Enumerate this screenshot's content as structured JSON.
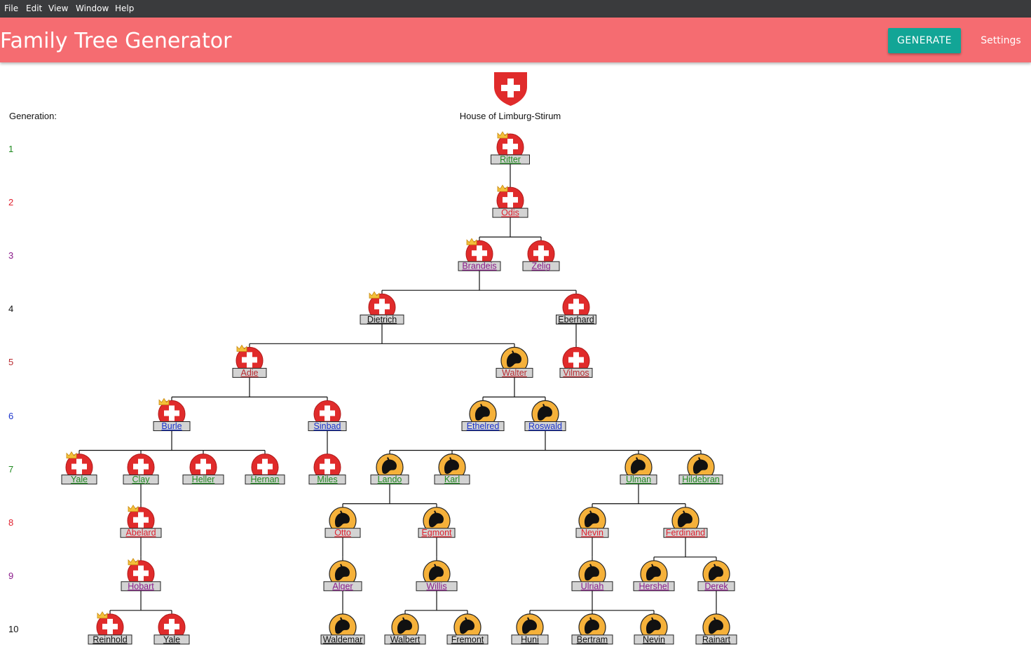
{
  "menu": [
    "File",
    "Edit",
    "View",
    "Window",
    "Help"
  ],
  "app": {
    "title": "Family Tree Generator",
    "generate_label": "GENERATE",
    "settings_label": "Settings"
  },
  "house": {
    "name": "House of Limburg-Stirum"
  },
  "generation_label": "Generation:",
  "generations": [
    {
      "n": "1",
      "color": "#1f8a1f"
    },
    {
      "n": "2",
      "color": "#e0202d"
    },
    {
      "n": "3",
      "color": "#8a1a8a"
    },
    {
      "n": "4",
      "color": "#111111"
    },
    {
      "n": "5",
      "color": "#b8282e"
    },
    {
      "n": "6",
      "color": "#1a33cc"
    },
    {
      "n": "7",
      "color": "#1f8a1f"
    },
    {
      "n": "8",
      "color": "#e0202d"
    },
    {
      "n": "9",
      "color": "#8a1a8a"
    },
    {
      "n": "10",
      "color": "#111111"
    }
  ],
  "colors": {
    "swiss_red": "#e02b2b",
    "lion_gold": "#f5b13a",
    "crown_gold": "#f3c03a",
    "label_bg": "#d3d3d3"
  },
  "people": [
    {
      "id": "ritter",
      "name": "Ritter",
      "gen": 1,
      "crest": "swiss",
      "crown": true
    },
    {
      "id": "odis",
      "name": "Odis",
      "gen": 2,
      "crest": "swiss",
      "crown": true,
      "parent": "ritter"
    },
    {
      "id": "brandeis",
      "name": "Brandeis",
      "gen": 3,
      "crest": "swiss",
      "crown": true,
      "parent": "odis"
    },
    {
      "id": "zelig",
      "name": "Zelig",
      "gen": 3,
      "crest": "swiss",
      "crown": false,
      "parent": "odis"
    },
    {
      "id": "dietrich",
      "name": "Dietrich",
      "gen": 4,
      "crest": "swiss",
      "crown": true,
      "parent": "brandeis"
    },
    {
      "id": "eberhard",
      "name": "Eberhard",
      "gen": 4,
      "crest": "swiss",
      "crown": false,
      "parent": "brandeis"
    },
    {
      "id": "adie",
      "name": "Adie",
      "gen": 5,
      "crest": "swiss",
      "crown": true,
      "parent": "dietrich"
    },
    {
      "id": "walter",
      "name": "Walter",
      "gen": 5,
      "crest": "lion",
      "crown": false,
      "parent": "dietrich"
    },
    {
      "id": "vilmos",
      "name": "Vilmos",
      "gen": 5,
      "crest": "swiss",
      "crown": false,
      "parent": "eberhard"
    },
    {
      "id": "burle",
      "name": "Burle",
      "gen": 6,
      "crest": "swiss",
      "crown": true,
      "parent": "adie"
    },
    {
      "id": "sinbad",
      "name": "Sinbad",
      "gen": 6,
      "crest": "swiss",
      "crown": false,
      "parent": "adie"
    },
    {
      "id": "ethelred",
      "name": "Ethelred",
      "gen": 6,
      "crest": "lion",
      "crown": false,
      "parent": "walter"
    },
    {
      "id": "roswald",
      "name": "Roswald",
      "gen": 6,
      "crest": "lion",
      "crown": false,
      "parent": "walter"
    },
    {
      "id": "yale7",
      "name": "Yale",
      "gen": 7,
      "crest": "swiss",
      "crown": true,
      "parent": "burle"
    },
    {
      "id": "clay",
      "name": "Clay",
      "gen": 7,
      "crest": "swiss",
      "crown": false,
      "parent": "burle"
    },
    {
      "id": "heller",
      "name": "Heller",
      "gen": 7,
      "crest": "swiss",
      "crown": false,
      "parent": "burle"
    },
    {
      "id": "hernan",
      "name": "Hernan",
      "gen": 7,
      "crest": "swiss",
      "crown": false,
      "parent": "burle"
    },
    {
      "id": "miles",
      "name": "Miles",
      "gen": 7,
      "crest": "swiss",
      "crown": false,
      "parent": "sinbad"
    },
    {
      "id": "lando",
      "name": "Lando",
      "gen": 7,
      "crest": "lion",
      "crown": false,
      "parent": "roswald"
    },
    {
      "id": "karl",
      "name": "Karl",
      "gen": 7,
      "crest": "lion",
      "crown": false,
      "parent": "roswald"
    },
    {
      "id": "ulman",
      "name": "Ulman",
      "gen": 7,
      "crest": "lion",
      "crown": false,
      "parent": "roswald"
    },
    {
      "id": "hildebran",
      "name": "Hildebran",
      "gen": 7,
      "crest": "lion",
      "crown": false,
      "parent": "roswald"
    },
    {
      "id": "abelard",
      "name": "Abelard",
      "gen": 8,
      "crest": "swiss",
      "crown": true,
      "parent": "clay"
    },
    {
      "id": "otto",
      "name": "Otto",
      "gen": 8,
      "crest": "lion",
      "crown": false,
      "parent": "lando"
    },
    {
      "id": "egmont",
      "name": "Egmont",
      "gen": 8,
      "crest": "lion",
      "crown": false,
      "parent": "lando"
    },
    {
      "id": "nevin8",
      "name": "Nevin",
      "gen": 8,
      "crest": "lion",
      "crown": false,
      "parent": "ulman"
    },
    {
      "id": "ferdinand",
      "name": "Ferdinand",
      "gen": 8,
      "crest": "lion",
      "crown": false,
      "parent": "ulman"
    },
    {
      "id": "hobart",
      "name": "Hobart",
      "gen": 9,
      "crest": "swiss",
      "crown": true,
      "parent": "abelard"
    },
    {
      "id": "alger",
      "name": "Alger",
      "gen": 9,
      "crest": "lion",
      "crown": false,
      "parent": "otto"
    },
    {
      "id": "willis",
      "name": "Willis",
      "gen": 9,
      "crest": "lion",
      "crown": false,
      "parent": "egmont"
    },
    {
      "id": "ulriah",
      "name": "Ulriah",
      "gen": 9,
      "crest": "lion",
      "crown": false,
      "parent": "nevin8"
    },
    {
      "id": "hershel",
      "name": "Hershel",
      "gen": 9,
      "crest": "lion",
      "crown": false,
      "parent": "ferdinand"
    },
    {
      "id": "derek",
      "name": "Derek",
      "gen": 9,
      "crest": "lion",
      "crown": false,
      "parent": "ferdinand"
    },
    {
      "id": "reinhold",
      "name": "Reinhold",
      "gen": 10,
      "crest": "swiss",
      "crown": true,
      "parent": "hobart"
    },
    {
      "id": "yale10",
      "name": "Yale",
      "gen": 10,
      "crest": "swiss",
      "crown": false,
      "parent": "hobart"
    },
    {
      "id": "waldemar",
      "name": "Waldemar",
      "gen": 10,
      "crest": "lion",
      "crown": false,
      "parent": "alger"
    },
    {
      "id": "walbert",
      "name": "Walbert",
      "gen": 10,
      "crest": "lion",
      "crown": false,
      "parent": "willis"
    },
    {
      "id": "fremont",
      "name": "Fremont",
      "gen": 10,
      "crest": "lion",
      "crown": false,
      "parent": "willis"
    },
    {
      "id": "huni",
      "name": "Huni",
      "gen": 10,
      "crest": "lion",
      "crown": false,
      "parent": "ulriah"
    },
    {
      "id": "bertram",
      "name": "Bertram",
      "gen": 10,
      "crest": "lion",
      "crown": false,
      "parent": "ulriah"
    },
    {
      "id": "nevin10",
      "name": "Nevin",
      "gen": 10,
      "crest": "lion",
      "crown": false,
      "parent": "ulriah"
    },
    {
      "id": "rainart",
      "name": "Rainart",
      "gen": 10,
      "crest": "lion",
      "crown": false,
      "parent": "derek"
    }
  ]
}
